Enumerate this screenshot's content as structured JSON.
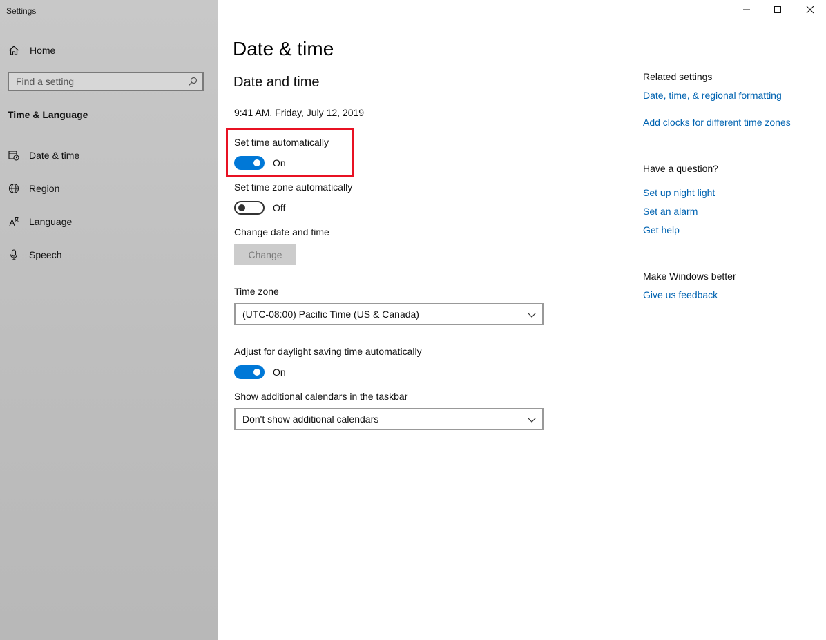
{
  "app": {
    "title": "Settings"
  },
  "sidebar": {
    "home_label": "Home",
    "search_placeholder": "Find a setting",
    "section": "Time & Language",
    "items": [
      {
        "label": "Date & time",
        "icon": "calendar-clock-icon"
      },
      {
        "label": "Region",
        "icon": "globe-icon"
      },
      {
        "label": "Language",
        "icon": "language-icon"
      },
      {
        "label": "Speech",
        "icon": "microphone-icon"
      }
    ]
  },
  "main": {
    "title": "Date & time",
    "subtitle": "Date and time",
    "current_datetime": "9:41 AM, Friday, July 12, 2019",
    "set_time_auto": {
      "label": "Set time automatically",
      "state": "On"
    },
    "set_timezone_auto": {
      "label": "Set time zone automatically",
      "state": "Off"
    },
    "change_date": {
      "label": "Change date and time",
      "button": "Change"
    },
    "time_zone": {
      "label": "Time zone",
      "value": "(UTC-08:00) Pacific Time (US & Canada)"
    },
    "dst": {
      "label": "Adjust for daylight saving time automatically",
      "state": "On"
    },
    "calendars": {
      "label": "Show additional calendars in the taskbar",
      "value": "Don't show additional calendars"
    }
  },
  "right": {
    "related_heading": "Related settings",
    "related_links": [
      "Date, time, & regional formatting",
      "Add clocks for different time zones"
    ],
    "question_heading": "Have a question?",
    "question_links": [
      "Set up night light",
      "Set an alarm",
      "Get help"
    ],
    "better_heading": "Make Windows better",
    "feedback_link": "Give us feedback"
  },
  "colors": {
    "accent": "#0078d7",
    "link": "#0063b1",
    "highlight": "#e81123"
  }
}
